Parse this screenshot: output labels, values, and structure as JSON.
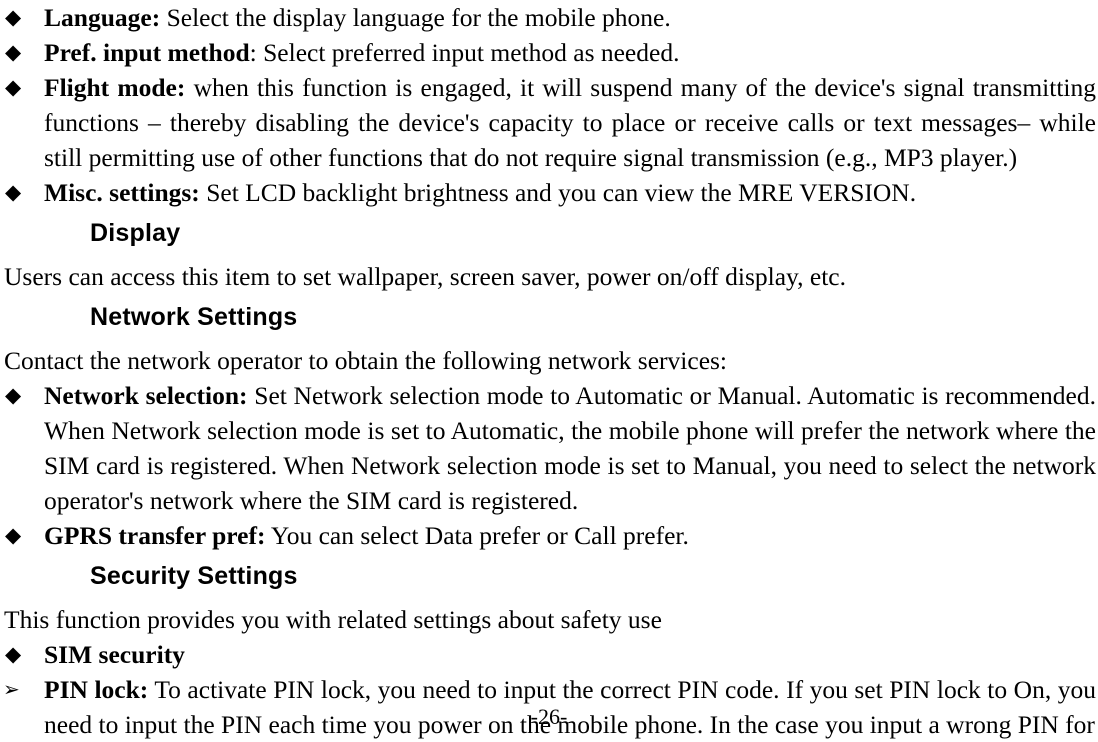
{
  "page": {
    "footer_label": "-26-"
  },
  "markers": {
    "diamond": "◆",
    "arrow": "➢"
  },
  "blocks": [
    {
      "kind": "bullet",
      "marker": "diamond",
      "lead": "Language:",
      "text": " Select the display language for the mobile phone."
    },
    {
      "kind": "bullet",
      "marker": "diamond",
      "lead": "Pref. input method",
      "text": ": Select preferred input method as needed."
    },
    {
      "kind": "bullet",
      "marker": "diamond",
      "lead": "Flight mode:",
      "text": " when this function is engaged, it will suspend many of the device's signal transmitting functions – thereby disabling the device's capacity to place or receive calls or text messages– while still permitting use of other functions that do not require signal transmission (e.g., MP3 player.)"
    },
    {
      "kind": "bullet",
      "marker": "diamond",
      "lead": "Misc. settings:",
      "text": " Set LCD backlight brightness and you can view the MRE VERSION."
    },
    {
      "kind": "heading",
      "text": "Display"
    },
    {
      "kind": "para",
      "text": "Users can access this item to set wallpaper, screen saver, power on/off display, etc."
    },
    {
      "kind": "heading",
      "text": "Network Settings"
    },
    {
      "kind": "para",
      "text": "Contact the network operator to obtain the following network services:"
    },
    {
      "kind": "bullet",
      "marker": "diamond",
      "lead": "Network selection:",
      "text": " Set Network selection mode to Automatic or Manual. Automatic is recommended. When Network selection mode is set to Automatic, the mobile phone will prefer the network where the SIM card is registered. When Network selection mode is set to Manual, you need to select the network operator's network where the SIM card is registered."
    },
    {
      "kind": "bullet",
      "marker": "diamond",
      "lead": "GPRS transfer pref:",
      "text": " You can select Data prefer or Call prefer."
    },
    {
      "kind": "heading",
      "text": "Security Settings"
    },
    {
      "kind": "para",
      "text": "This function provides you with related settings about safety use"
    },
    {
      "kind": "bullet",
      "marker": "diamond",
      "lead": "SIM security",
      "text": ""
    },
    {
      "kind": "bullet",
      "marker": "arrow",
      "lead": "PIN lock:",
      "text": " To activate PIN lock, you need to input the correct PIN code. If you set PIN lock to On, you need to input the PIN each time you power on the mobile phone. In the case you input a wrong PIN for"
    }
  ]
}
